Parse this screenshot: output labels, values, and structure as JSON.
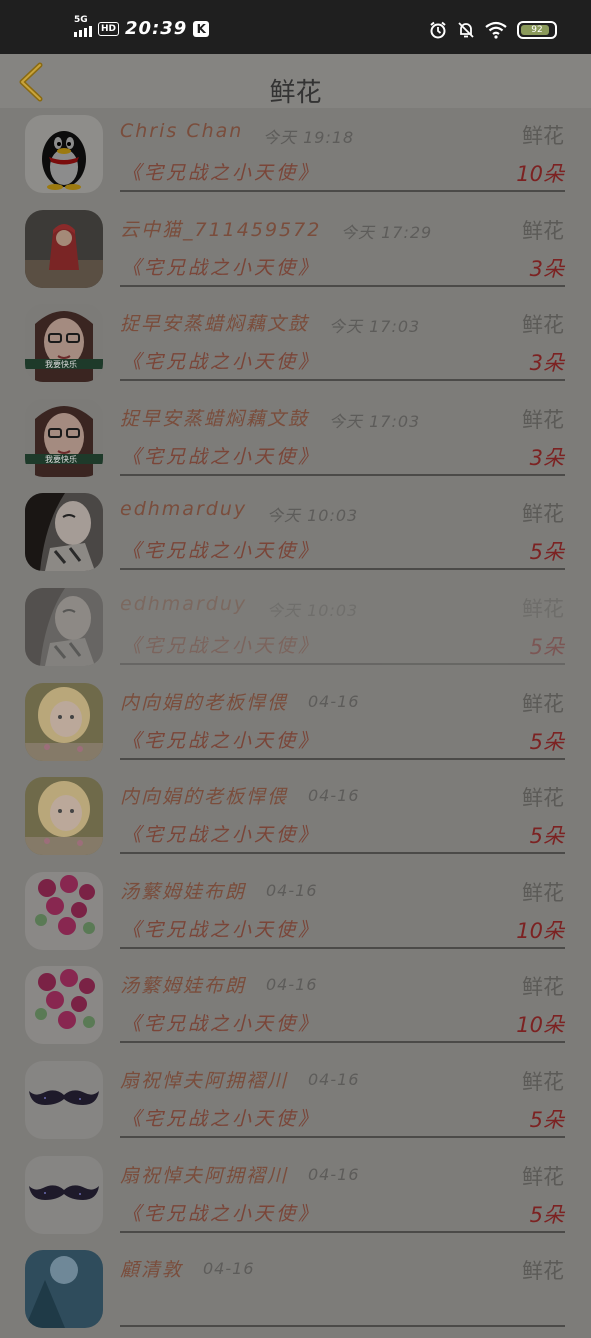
{
  "status_bar": {
    "network": "5G",
    "hd": "HD",
    "time": "20:39",
    "k_badge": "K",
    "battery": "92"
  },
  "header": {
    "title": "鲜花"
  },
  "colors": {
    "background": "#7d7c79",
    "status_bar": "#1f1f1f",
    "name_color": "#7a4d3c",
    "count_color": "#7c2222",
    "back_arrow": "#8a6a12"
  },
  "rows": [
    {
      "name": "Chris Chan",
      "time": "今天 19:18",
      "type": "鲜花",
      "book": "《宅兄战之小天使》",
      "count": "10朵",
      "avatar": "penguin-avatar"
    },
    {
      "name": "云中猫_711459572",
      "time": "今天 17:29",
      "type": "鲜花",
      "book": "《宅兄战之小天使》",
      "count": "3朵",
      "avatar": "child-red-coat-avatar"
    },
    {
      "name": "捉早安蒸蜡焖藕文鼓",
      "time": "今天 17:03",
      "type": "鲜花",
      "book": "《宅兄战之小天使》",
      "count": "3朵",
      "avatar": "girl-glasses-avatar"
    },
    {
      "name": "捉早安蒸蜡焖藕文鼓",
      "time": "今天 17:03",
      "type": "鲜花",
      "book": "《宅兄战之小天使》",
      "count": "3朵",
      "avatar": "girl-glasses-avatar"
    },
    {
      "name": "edhmarduy",
      "time": "今天 10:03",
      "type": "鲜花",
      "book": "《宅兄战之小天使》",
      "count": "5朵",
      "avatar": "woman-portrait-avatar"
    },
    {
      "name": "edhmarduy",
      "time": "今天 10:03",
      "type": "鲜花",
      "book": "《宅兄战之小天使》",
      "count": "5朵",
      "avatar": "woman-portrait-avatar"
    },
    {
      "name": "内向娟的老板悍偎",
      "time": "04-16",
      "type": "鲜花",
      "book": "《宅兄战之小天使》",
      "count": "5朵",
      "avatar": "blonde-child-avatar"
    },
    {
      "name": "内向娟的老板悍偎",
      "time": "04-16",
      "type": "鲜花",
      "book": "《宅兄战之小天使》",
      "count": "5朵",
      "avatar": "blonde-child-avatar"
    },
    {
      "name": "汤蘩姆娃布朗",
      "time": "04-16",
      "type": "鲜花",
      "book": "《宅兄战之小天使》",
      "count": "10朵",
      "avatar": "pink-roses-avatar"
    },
    {
      "name": "汤蘩姆娃布朗",
      "time": "04-16",
      "type": "鲜花",
      "book": "《宅兄战之小天使》",
      "count": "10朵",
      "avatar": "pink-roses-avatar"
    },
    {
      "name": "扇祝悼夫阿拥褶川",
      "time": "04-16",
      "type": "鲜花",
      "book": "《宅兄战之小天使》",
      "count": "5朵",
      "avatar": "mustache-avatar"
    },
    {
      "name": "扇祝悼夫阿拥褶川",
      "time": "04-16",
      "type": "鲜花",
      "book": "《宅兄战之小天使》",
      "count": "5朵",
      "avatar": "mustache-avatar"
    },
    {
      "name": "顧清敦",
      "time": "04-16",
      "type": "鲜花",
      "book": "",
      "count": "",
      "avatar": "blue-scene-avatar"
    }
  ]
}
